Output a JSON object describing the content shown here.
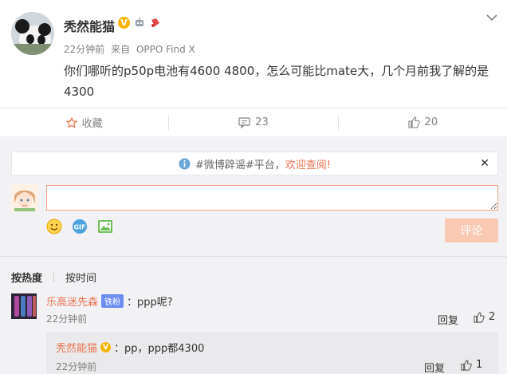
{
  "post": {
    "author": "秃然能猫",
    "verified_badge": "V",
    "time": "22分钟前",
    "source_prefix": "来自",
    "source": "OPPO Find X",
    "content": "你们哪听的p50p电池有4600 4800，怎么可能比mate大，几个月前我了解的是4300"
  },
  "actions": {
    "favorite_label": "收藏",
    "comment_count": "23",
    "like_count": "20"
  },
  "comment_box": {
    "notice_text": "#微博辟谣#平台，",
    "notice_link": "欢迎查阅!",
    "input_value": "",
    "submit_label": "评论"
  },
  "sort": {
    "by_hot": "按热度",
    "by_time": "按时间"
  },
  "comments": [
    {
      "user": "乐高迷先森",
      "badge": "铁粉",
      "text": "：ppp呢?",
      "time": "22分钟前",
      "reply_label": "回复",
      "likes": "2",
      "replies": [
        {
          "user": "秃然能猫",
          "text": "：pp，ppp都4300",
          "time": "22分钟前",
          "reply_label": "回复",
          "likes": "1"
        }
      ]
    }
  ],
  "colors": {
    "accent": "#eb7350",
    "verified": "#f7b500",
    "fan_badge": "#6b8df0",
    "comment_bg": "#f2f2f5"
  }
}
